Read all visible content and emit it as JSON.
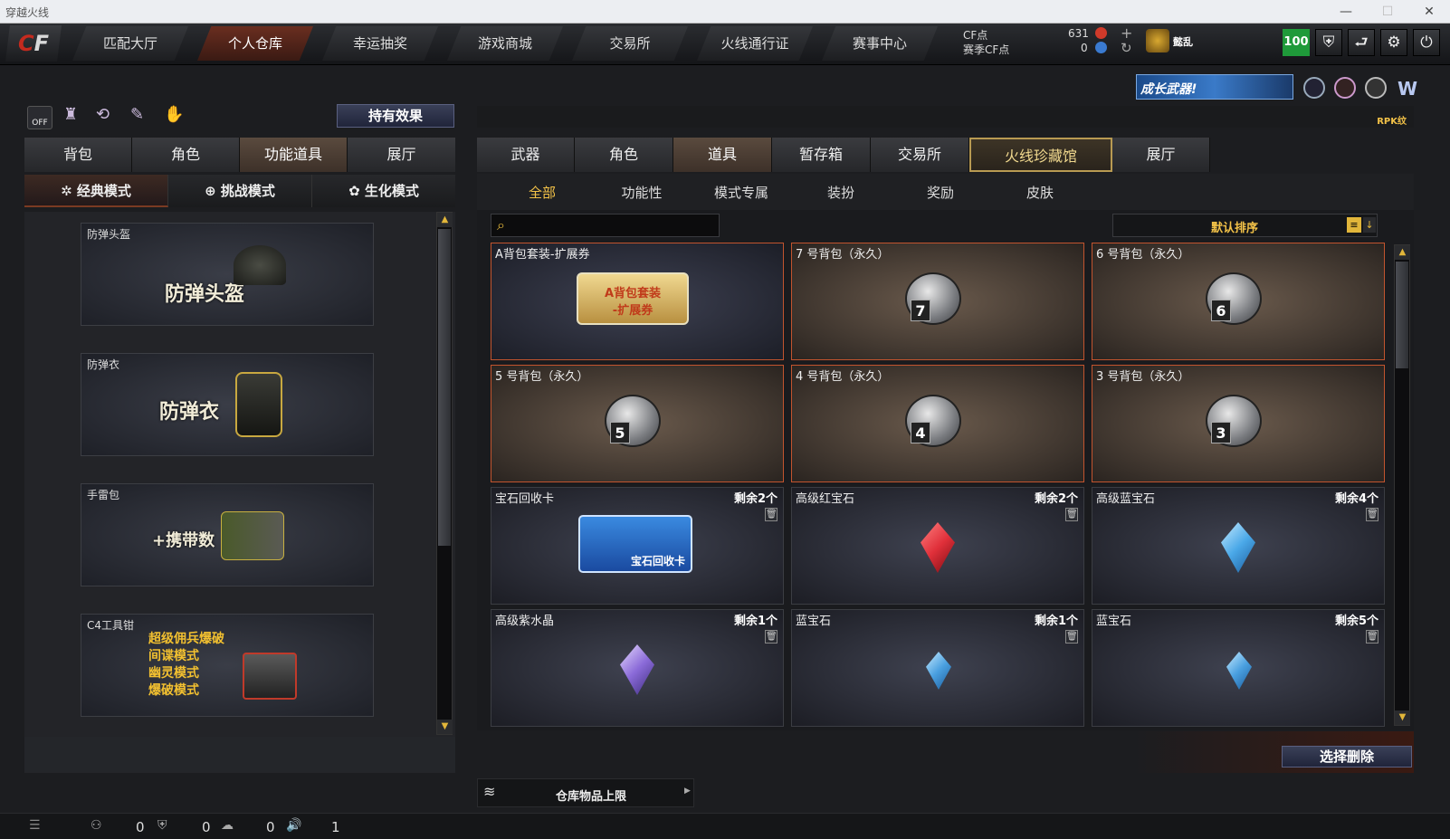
{
  "window": {
    "title": "穿越火线",
    "min": "—",
    "max": "☐",
    "close": "✕"
  },
  "logo": {
    "a": "C",
    "b": "F"
  },
  "nav": {
    "tabs": [
      "匹配大厅",
      "个人仓库",
      "幸运抽奖",
      "游戏商城",
      "交易所",
      "火线通行证",
      "赛事中心"
    ],
    "active": 1
  },
  "currency": {
    "cf_label": "CF点",
    "cf_value": "631",
    "season_label": "赛季CF点",
    "season_value": "0",
    "user_tag": "懿乱",
    "level": "100"
  },
  "banner": {
    "text": "成长武器!"
  },
  "rpk": "RPK纹",
  "left": {
    "holding_effect": "持有效果",
    "off": "OFF",
    "tabs": [
      "背包",
      "角色",
      "功能道具",
      "展厅"
    ],
    "active_tab": 2,
    "modes": [
      "经典模式",
      "挑战模式",
      "生化模式"
    ],
    "active_mode": 0,
    "cards": [
      {
        "label": "防弹头盔",
        "art": "防弹头盔"
      },
      {
        "label": "防弹衣",
        "art": "防弹衣"
      },
      {
        "label": "手雷包",
        "art": "+携带数"
      },
      {
        "label": "C4工具钳",
        "art_lines": [
          "超级佣兵爆破",
          "间谍模式",
          "幽灵模式",
          "爆破模式"
        ]
      }
    ]
  },
  "right": {
    "tabs": [
      "武器",
      "角色",
      "道具",
      "暂存箱",
      "交易所",
      "火线珍藏馆",
      "展厅"
    ],
    "active_tab": 2,
    "special_tab": 5,
    "subtabs": [
      "全部",
      "功能性",
      "模式专属",
      "装扮",
      "奖励",
      "皮肤"
    ],
    "active_sub": 0,
    "search": {
      "placeholder": ""
    },
    "sort": "默认排序",
    "items": [
      {
        "name": "A背包套装-扩展券",
        "remain": "",
        "art": "A背包套装\n-扩展券",
        "type": "ticket"
      },
      {
        "name": "7 号背包（永久）",
        "remain": "",
        "bag": "7",
        "type": "bag"
      },
      {
        "name": "6 号背包（永久）",
        "remain": "",
        "bag": "6",
        "type": "bag"
      },
      {
        "name": "5 号背包（永久）",
        "remain": "",
        "bag": "5",
        "type": "bag"
      },
      {
        "name": "4 号背包（永久）",
        "remain": "",
        "bag": "4",
        "type": "bag"
      },
      {
        "name": "3 号背包（永久）",
        "remain": "",
        "bag": "3",
        "type": "bag"
      },
      {
        "name": "宝石回收卡",
        "remain": "剩余2个",
        "art": "宝石回收卡",
        "type": "card"
      },
      {
        "name": "高级红宝石",
        "remain": "剩余2个",
        "color": "#e0303a",
        "type": "gem"
      },
      {
        "name": "高级蓝宝石",
        "remain": "剩余4个",
        "color": "#4aa8e8",
        "type": "gem"
      },
      {
        "name": "高级紫水晶",
        "remain": "剩余1个",
        "color": "#8a6ad8",
        "type": "gem"
      },
      {
        "name": "蓝宝石",
        "remain": "剩余1个",
        "color": "#4aa0e0",
        "type": "gem"
      },
      {
        "name": "蓝宝石",
        "remain": "剩余5个",
        "color": "#4aa0e0",
        "type": "gem"
      }
    ],
    "delete_btn": "选择删除",
    "capacity": "仓库物品上限"
  },
  "status": {
    "v1": "0",
    "v2": "0",
    "v3": "0",
    "v4": "1"
  }
}
